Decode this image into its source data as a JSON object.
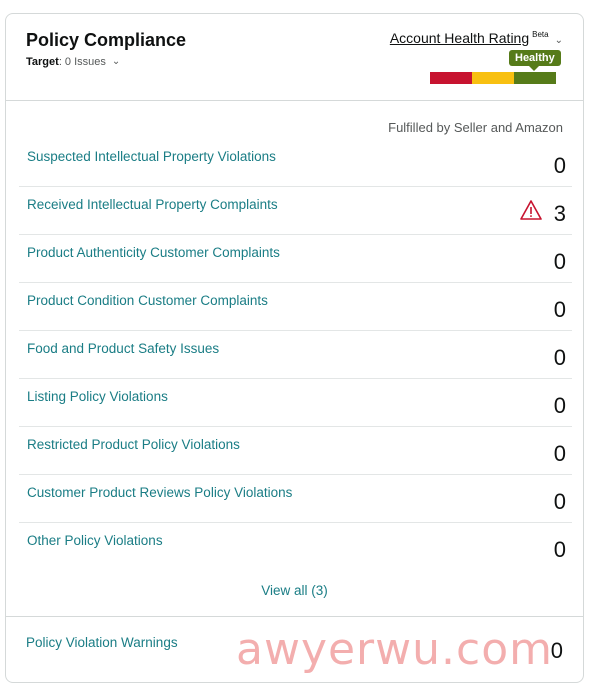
{
  "header": {
    "title": "Policy Compliance",
    "target_label": "Target",
    "target_value": ": 0 Issues",
    "ahr_label": "Account Health Rating",
    "ahr_beta": "Beta",
    "status_label": "Healthy",
    "bar_colors": [
      "#c7132f",
      "#f8c011",
      "#567b19"
    ]
  },
  "table": {
    "column_header": "Fulfilled by Seller and Amazon",
    "rows": [
      {
        "label": "Suspected Intellectual Property Violations",
        "value": "0"
      },
      {
        "label": "Received Intellectual Property Complaints",
        "value": "3",
        "warning": true
      },
      {
        "label": "Product Authenticity Customer Complaints",
        "value": "0"
      },
      {
        "label": "Product Condition Customer Complaints",
        "value": "0"
      },
      {
        "label": "Food and Product Safety Issues",
        "value": "0"
      },
      {
        "label": "Listing Policy Violations",
        "value": "0"
      },
      {
        "label": "Restricted Product Policy Violations",
        "value": "0"
      },
      {
        "label": "Customer Product Reviews Policy Violations",
        "value": "0"
      },
      {
        "label": "Other Policy Violations",
        "value": "0"
      }
    ],
    "view_all": "View all (3)"
  },
  "warnings": {
    "label": "Policy Violation Warnings",
    "value": "0"
  },
  "watermark": "awyerwu.com",
  "colors": {
    "link": "#1a7d85",
    "warning_icon": "#c7132f"
  }
}
